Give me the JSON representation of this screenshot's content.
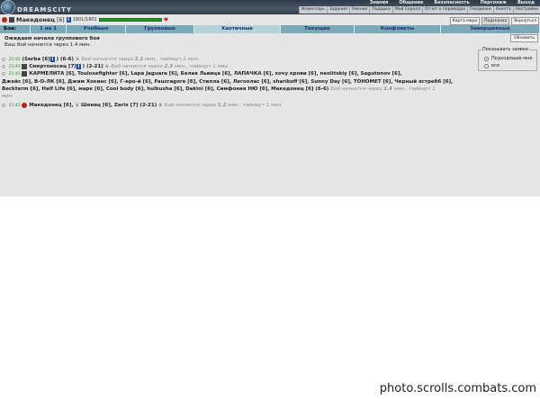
{
  "header": {
    "logo_text": "DREAMSCITY",
    "top_links": [
      "Знания",
      "Общение",
      "Безопасность",
      "Персонаж",
      "Выход"
    ],
    "bottom_links": [
      "Инвентарь",
      "Задания",
      "Умения",
      "Подарки",
      "Мой Скролл",
      "Отчет о переводах",
      "Поединки",
      "Анкета",
      "Настройки"
    ]
  },
  "player": {
    "nick": "Македонец",
    "level": "[6]",
    "hp": "1801/1801",
    "hp_fraction": 1.0
  },
  "buttons": {
    "map": "Карта мира",
    "hint": "Подсказка",
    "back": "Вернуться",
    "refresh": "Обновить"
  },
  "tabs": {
    "label": "Бои:",
    "items": [
      "1 на 1",
      "Учебные",
      "Групповые",
      "Хаотичные",
      "Текущие",
      "Конфликты",
      "Завершенные"
    ],
    "active_index": 3
  },
  "status": {
    "title": "Ожидаем начала группового боя",
    "subtitle": "Ваш бой начнется через 1.4 мин."
  },
  "filter": {
    "legend": "Показывать заявки",
    "option_fit": "Подходящие мне",
    "option_all": "все",
    "selected": "Подходящие мне"
  },
  "battles": [
    {
      "time": "21:42",
      "text_a": "(Serba [6]",
      "text_b": ") (6-6)",
      "note": "Бой начнется через",
      "mins": "3.1",
      "tail": "мин., таймаут 1 мин."
    },
    {
      "time": "21:41",
      "text_a": "Смертоносец [7]",
      "text_b": ") (2-21)",
      "note": "Бой начнется через",
      "mins": "2.3",
      "tail": "мин., таймаут 1 мин."
    },
    {
      "time": "21:41",
      "line1": "КАРМЕЛИТА [6], Toulosefighter [6], Lapa Jaguara [6], Белая Львица [6], ЛАПАЧКА [6], хочу крови [6], neolitskiy [6], Sagutonov [6],",
      "line2": "Джейс [6], В-О-ЛК [6], Джим Хокинс [6], Г-еро-й [6], Fauzragore [6], Стилла [6], Легоолас [6], sharikoff [6], Sunny Day [6], ТОНОМЕТ [6], Черный ястреб6 [6],",
      "line3": "Beckterm [6], Half Life [6], марк [6], Cool body [6], hulkusha [6], Dakini [6], Симфония НЮ [6], Македонец [6] (6-6)",
      "note": "Бой начнется через",
      "mins": "1.4",
      "tail": "мин., таймаут 1",
      "line4": "мин."
    },
    {
      "time": "21:42",
      "text_a": "Македонец [6],",
      "text_b": "Шенец [6], Zarix [7] (2-21)",
      "note": "Бой начнется через",
      "mins": "1.2",
      "tail": "мин., таймаут 1 мин."
    }
  ],
  "watermark": "photo.scrolls.combats.com",
  "colors": {
    "tab_bar": "#7aaab8",
    "tab_active": "#b6d2d9",
    "tab_text": "#1d2f7a",
    "hp_bar": "#1a9e1a",
    "time_text": "#2a8a2a"
  }
}
